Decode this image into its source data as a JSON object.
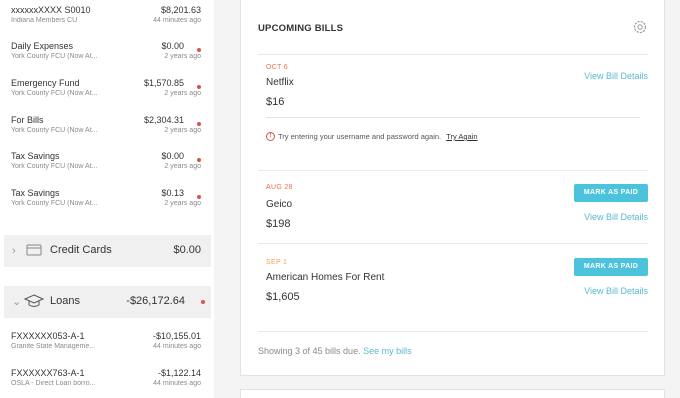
{
  "sidebar": {
    "accounts_top": [
      {
        "name": "xxxxxxXXXX S0010",
        "institution": "Indiana Members CU",
        "balance": "$8,201.63",
        "time": "44 minutes ago",
        "alert": false
      },
      {
        "name": "Daily Expenses",
        "institution": "York County FCU (Now At...",
        "balance": "$0.00",
        "time": "2 years ago",
        "alert": true
      },
      {
        "name": "Emergency Fund",
        "institution": "York County FCU (Now At...",
        "balance": "$1,570.85",
        "time": "2 years ago",
        "alert": true
      },
      {
        "name": "For Bills",
        "institution": "York County FCU (Now At...",
        "balance": "$2,304.31",
        "time": "2 years ago",
        "alert": true
      },
      {
        "name": "Tax Savings",
        "institution": "York County FCU (Now At...",
        "balance": "$0.00",
        "time": "2 years ago",
        "alert": true
      },
      {
        "name": "Tax Savings",
        "institution": "York County FCU (Now At...",
        "balance": "$0.13",
        "time": "2 years ago",
        "alert": true
      }
    ],
    "credit_cards": {
      "label": "Credit Cards",
      "amount": "$0.00"
    },
    "loans": {
      "label": "Loans",
      "amount": "-$26,172.64"
    },
    "loan_accounts": [
      {
        "name": "FXXXXXX053-A-1",
        "institution": "Granite State Manageme...",
        "balance": "-$10,155.01",
        "time": "44 minutes ago"
      },
      {
        "name": "FXXXXXX763-A-1",
        "institution": "OSLA - Direct Loan borro...",
        "balance": "-$1,122.14",
        "time": "44 minutes ago"
      }
    ]
  },
  "bills": {
    "title": "UPCOMING BILLS",
    "items": [
      {
        "date": "OCT 6",
        "date_color": "#e8734a",
        "name": "Netflix",
        "amount": "$16",
        "view": "View Bill Details",
        "mark": ""
      },
      {
        "date": "AUG 28",
        "date_color": "#e8734a",
        "name": "Geico",
        "amount": "$198",
        "view": "View Bill Details",
        "mark": "MARK AS PAID"
      },
      {
        "date": "SEP 1",
        "date_color": "#f0a050",
        "name": "American Homes For Rent",
        "amount": "$1,605",
        "view": "View Bill Details",
        "mark": "MARK AS PAID"
      }
    ],
    "error_text": "Try entering your username and password again.",
    "error_link": "Try Again",
    "footer_text": "Showing 3 of 45 bills due.",
    "footer_link": "See my bills"
  },
  "icons": {
    "settings": "gear-icon",
    "credit_card": "credit-card-icon",
    "loans": "graduation-cap-icon",
    "error": "error-circle-icon"
  },
  "colors": {
    "accent": "#5bb8d4",
    "button": "#4cc3dc",
    "alert_dot": "#d9534f"
  }
}
